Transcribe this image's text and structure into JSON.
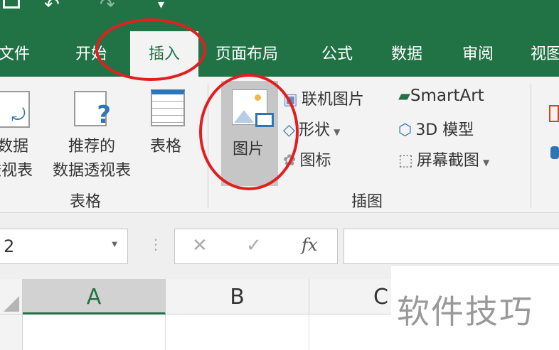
{
  "quick_access": {
    "save": "save-icon",
    "undo": "↶",
    "redo": "↷",
    "customize": "▾"
  },
  "tabs": [
    "文件",
    "开始",
    "插入",
    "页面布局",
    "公式",
    "数据",
    "审阅",
    "视图"
  ],
  "active_tab": "插入",
  "ribbon": {
    "tables_group": {
      "label": "表格",
      "pivot": [
        "数据",
        "透视表"
      ],
      "recommended": [
        "推荐的",
        "数据透视表"
      ],
      "table": "表格"
    },
    "illustrations_group": {
      "label": "插图",
      "pictures": "图片",
      "online_pictures": "联机图片",
      "shapes": "形状",
      "icons": "图标",
      "smartart": "SmartArt",
      "model3d": "3D 模型",
      "screenshot": "屏幕截图"
    }
  },
  "formula_bar": {
    "name_box": "2",
    "cancel": "✕",
    "enter": "✓",
    "fx": "fx",
    "value": ""
  },
  "columns": [
    "A",
    "B",
    "C"
  ],
  "watermark": "软件技巧",
  "colors": {
    "green": "#217346",
    "highlight": "#e02020"
  }
}
